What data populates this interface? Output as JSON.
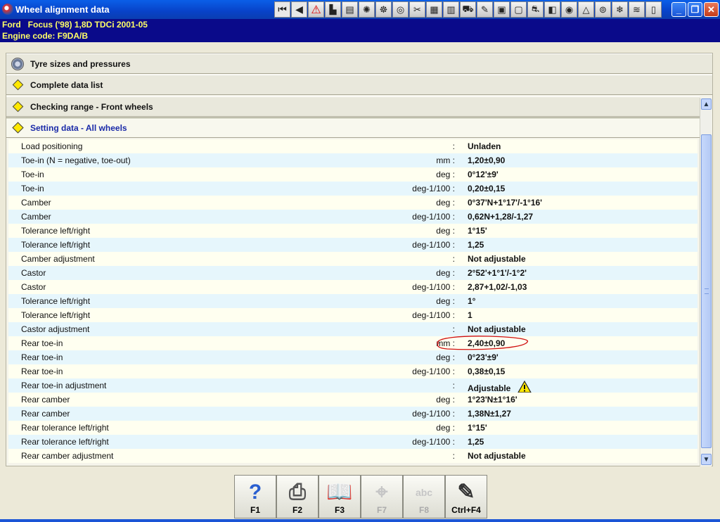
{
  "window": {
    "title": "Wheel alignment data"
  },
  "toolbar_icons": [
    "first-icon",
    "prev-icon",
    "warning-icon",
    "flag-icon",
    "chart-icon",
    "engine-icon",
    "steering-icon",
    "wheel-icon",
    "tools-icon",
    "diagram-icon",
    "battery-icon",
    "car-lift-icon",
    "pen-icon",
    "relay-icon",
    "gauge-icon",
    "car-icon",
    "lock-icon",
    "dashboard-icon",
    "adjust-icon",
    "tyre-icon",
    "ac-icon",
    "car-wash-icon",
    "page-icon"
  ],
  "vehicle": {
    "line1": "Ford   Focus ('98) 1,8D TDCi 2001-05",
    "line2": "Engine code: F9DA/B"
  },
  "sections": [
    {
      "label": "Tyre sizes and pressures"
    },
    {
      "label": "Complete data list"
    },
    {
      "label": "Checking range - Front wheels"
    },
    {
      "label": "Setting data - All wheels"
    }
  ],
  "rows": [
    {
      "label": "Load positioning",
      "unit": ":",
      "value": "Unladen"
    },
    {
      "label": "Toe-in (N = negative, toe-out)",
      "unit": "mm :",
      "value": "1,20±0,90"
    },
    {
      "label": "Toe-in",
      "unit": "deg :",
      "value": "0°12'±9'"
    },
    {
      "label": "Toe-in",
      "unit": "deg-1/100 :",
      "value": "0,20±0,15"
    },
    {
      "label": "Camber",
      "unit": "deg :",
      "value": "0°37'N+1°17'/-1°16'"
    },
    {
      "label": "Camber",
      "unit": "deg-1/100 :",
      "value": "0,62N+1,28/-1,27"
    },
    {
      "label": "Tolerance left/right",
      "unit": "deg :",
      "value": "1°15'"
    },
    {
      "label": "Tolerance left/right",
      "unit": "deg-1/100 :",
      "value": "1,25"
    },
    {
      "label": "Camber adjustment",
      "unit": ":",
      "value": "Not adjustable"
    },
    {
      "label": "Castor",
      "unit": "deg :",
      "value": "2°52'+1°1'/-1°2'"
    },
    {
      "label": "Castor",
      "unit": "deg-1/100 :",
      "value": "2,87+1,02/-1,03"
    },
    {
      "label": "Tolerance left/right",
      "unit": "deg :",
      "value": "1°"
    },
    {
      "label": "Tolerance left/right",
      "unit": "deg-1/100 :",
      "value": "1"
    },
    {
      "label": "Castor adjustment",
      "unit": ":",
      "value": "Not adjustable"
    },
    {
      "label": "Rear toe-in",
      "unit": "mm :",
      "value": "2,40±0,90"
    },
    {
      "label": "Rear toe-in",
      "unit": "deg :",
      "value": "0°23'±9'"
    },
    {
      "label": "Rear toe-in",
      "unit": "deg-1/100 :",
      "value": "0,38±0,15"
    },
    {
      "label": "Rear toe-in adjustment",
      "unit": ":",
      "value": "Adjustable"
    },
    {
      "label": "Rear camber",
      "unit": "deg :",
      "value": "1°23'N±1°16'"
    },
    {
      "label": "Rear camber",
      "unit": "deg-1/100 :",
      "value": "1,38N±1,27"
    },
    {
      "label": "Rear tolerance left/right",
      "unit": "deg :",
      "value": "1°15'"
    },
    {
      "label": "Rear tolerance left/right",
      "unit": "deg-1/100 :",
      "value": "1,25"
    },
    {
      "label": "Rear camber adjustment",
      "unit": ":",
      "value": "Not adjustable"
    }
  ],
  "function_keys": [
    {
      "key": "F1",
      "icon": "help-icon",
      "enabled": true
    },
    {
      "key": "F2",
      "icon": "print-icon",
      "enabled": true
    },
    {
      "key": "F3",
      "icon": "book-icon",
      "enabled": true
    },
    {
      "key": "F7",
      "icon": "magnify-icon",
      "enabled": false
    },
    {
      "key": "F8",
      "icon": "abc-icon",
      "enabled": false
    },
    {
      "key": "Ctrl+F4",
      "icon": "notes-icon",
      "enabled": true
    }
  ],
  "colors": {
    "title_bar": "#0a5fe8",
    "vehicle_bar": "#0a0a8a",
    "vehicle_text": "#ffff66",
    "active_section": "#1a2aa8",
    "highlight_circle": "#d01010"
  }
}
